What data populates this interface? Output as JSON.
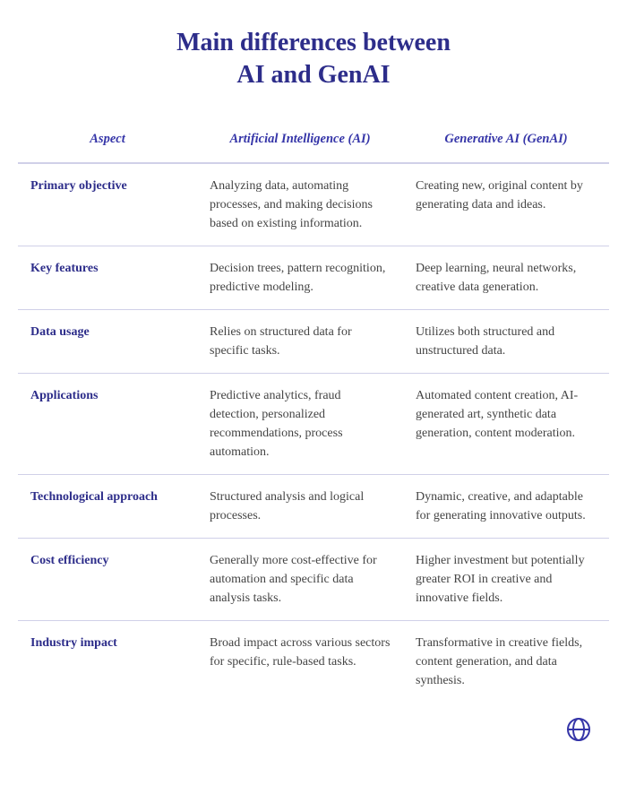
{
  "title": {
    "line1": "Main differences between",
    "line2": "AI and GenAI"
  },
  "table": {
    "header": {
      "aspect": "Aspect",
      "ai": "Artificial Intelligence (AI)",
      "genai": "Generative AI (GenAI)"
    },
    "rows": [
      {
        "aspect": "Primary objective",
        "ai": "Analyzing data, automating processes, and making decisions based on existing information.",
        "genai": "Creating new, original content by generating data and ideas."
      },
      {
        "aspect": "Key features",
        "ai": "Decision trees, pattern recognition, predictive modeling.",
        "genai": "Deep learning, neural networks, creative data generation."
      },
      {
        "aspect": "Data usage",
        "ai": "Relies on structured data for specific tasks.",
        "genai": "Utilizes both structured and unstructured data."
      },
      {
        "aspect": "Applications",
        "ai": "Predictive analytics, fraud detection, personalized recommendations, process automation.",
        "genai": "Automated content creation, AI-generated art, synthetic data generation, content moderation."
      },
      {
        "aspect": "Technological approach",
        "ai": "Structured analysis and logical processes.",
        "genai": "Dynamic, creative, and adaptable for generating innovative outputs."
      },
      {
        "aspect": "Cost efficiency",
        "ai": "Generally more cost-effective for automation and specific data analysis tasks.",
        "genai": "Higher investment but potentially greater ROI in creative and innovative fields."
      },
      {
        "aspect": "Industry impact",
        "ai": "Broad impact across various sectors for specific, rule-based tasks.",
        "genai": "Transformative in creative fields, content generation, and data synthesis."
      }
    ]
  }
}
